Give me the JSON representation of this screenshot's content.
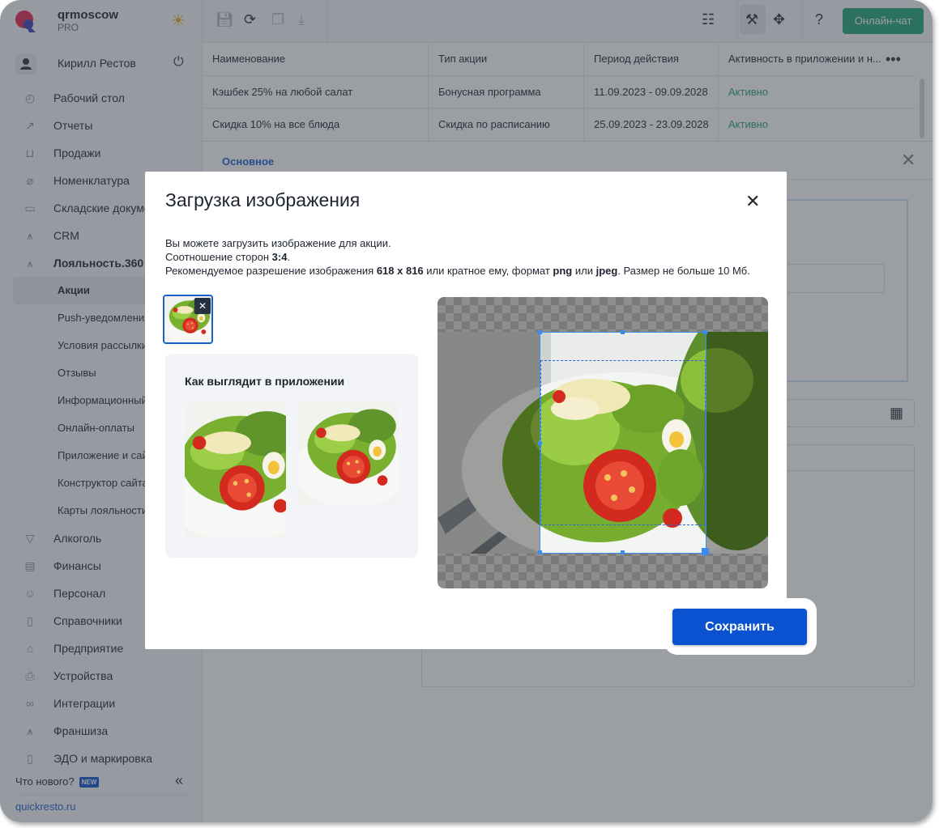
{
  "brand": {
    "company": "qrmoscow",
    "plan": "PRO"
  },
  "user": {
    "name": "Кирилл Рестов"
  },
  "nav": {
    "items": [
      {
        "label": "Рабочий стол",
        "icon": "dashboard-icon"
      },
      {
        "label": "Отчеты",
        "icon": "chart-icon"
      },
      {
        "label": "Продажи",
        "icon": "basket-icon"
      },
      {
        "label": "Номенклатура",
        "icon": "tag-icon"
      },
      {
        "label": "Складские документы",
        "icon": "archive-icon"
      },
      {
        "label": "CRM",
        "icon": "crm-icon"
      },
      {
        "label": "Лояльность.360",
        "icon": "loyalty-icon"
      }
    ],
    "sub_items": [
      "Акции",
      "Push-уведомления",
      "Условия рассылки",
      "Отзывы",
      "Информационный блок",
      "Онлайн-оплаты",
      "Приложение и сайт",
      "Конструктор сайта",
      "Карты лояльности"
    ],
    "items2": [
      {
        "label": "Алкоголь",
        "icon": "glass-icon"
      },
      {
        "label": "Финансы",
        "icon": "wallet-icon"
      },
      {
        "label": "Персонал",
        "icon": "people-icon"
      },
      {
        "label": "Справочники",
        "icon": "book-icon"
      },
      {
        "label": "Предприятие",
        "icon": "store-icon"
      },
      {
        "label": "Устройства",
        "icon": "printer-icon"
      },
      {
        "label": "Интеграции",
        "icon": "infinity-icon"
      },
      {
        "label": "Франшиза",
        "icon": "franchise-icon"
      },
      {
        "label": "ЭДО и маркировка",
        "icon": "document-icon"
      }
    ]
  },
  "footer": {
    "whats_new": "Что нового?",
    "new_badge": "NEW",
    "site": "quickresto.ru"
  },
  "toolbar": {
    "chat": "Онлайн-чат"
  },
  "grid": {
    "columns": [
      "Наименование",
      "Тип акции",
      "Период действия",
      "Активность в приложении и н..."
    ],
    "rows": [
      [
        "Кэшбек 25% на любой салат",
        "Бонусная программа",
        "11.09.2023 - 09.09.2028",
        "Активно"
      ],
      [
        "Скидка 10% на все блюда",
        "Скидка по расписанию",
        "25.09.2023 - 23.09.2028",
        "Активно"
      ]
    ]
  },
  "detail": {
    "tab": "Основное"
  },
  "modal": {
    "title": "Загрузка изображения",
    "desc_line1": "Вы можете загрузить изображение для акции.",
    "desc_ratio_prefix": "Соотношение сторон ",
    "desc_ratio": "3:4",
    "desc_ratio_suffix": ".",
    "desc_res_prefix": "Рекомендуемое разрешение изображения ",
    "desc_res": "618 x 816",
    "desc_res_mid": " или кратное ему, формат ",
    "desc_fmt1": "png",
    "desc_or": " или ",
    "desc_fmt2": "jpeg",
    "desc_res_suffix": ". Размер не больше 10 Мб.",
    "preview_title": "Как выглядит в приложении",
    "save": "Сохранить"
  },
  "colors": {
    "accent": "#0a52cf",
    "green": "#22a578",
    "link": "#1a5fd0"
  }
}
